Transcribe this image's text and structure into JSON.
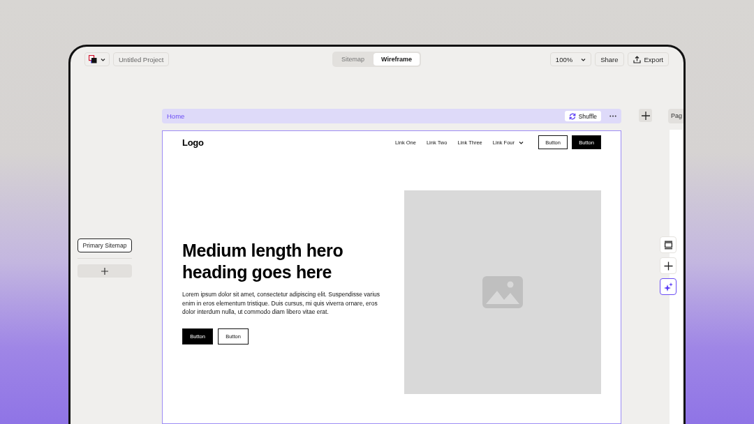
{
  "toolbar": {
    "project_name": "Untitled Project",
    "view_tabs": [
      {
        "label": "Sitemap",
        "selected": false
      },
      {
        "label": "Wireframe",
        "selected": true
      }
    ],
    "zoom": "100%",
    "share": "Share",
    "export": "Export"
  },
  "sidebar": {
    "sitemaps": [
      {
        "label": "Primary Sitemap",
        "selected": true
      }
    ]
  },
  "page_bar": {
    "title": "Home",
    "shuffle": "Shuffle"
  },
  "next_page_tab": "Pag",
  "wireframe": {
    "logo": "Logo",
    "nav_links": [
      {
        "label": "Link One",
        "dropdown": false
      },
      {
        "label": "Link Two",
        "dropdown": false
      },
      {
        "label": "Link Three",
        "dropdown": false
      },
      {
        "label": "Link Four",
        "dropdown": true
      }
    ],
    "nav_buttons": [
      {
        "label": "Button",
        "kind": "outline"
      },
      {
        "label": "Button",
        "kind": "solid"
      }
    ],
    "hero": {
      "heading": "Medium length hero heading goes here",
      "body": "Lorem ipsum dolor sit amet, consectetur adipiscing elit. Suspendisse varius enim in eros elementum tristique. Duis cursus, mi quis viverra ornare, eros dolor interdum nulla, ut commodo diam libero vitae erat.",
      "buttons": [
        {
          "label": "Button",
          "kind": "solid"
        },
        {
          "label": "Button",
          "kind": "outline"
        }
      ]
    }
  },
  "tools": [
    {
      "kind": "layout",
      "active": false
    },
    {
      "kind": "add",
      "active": false
    },
    {
      "kind": "ai",
      "active": true
    }
  ]
}
